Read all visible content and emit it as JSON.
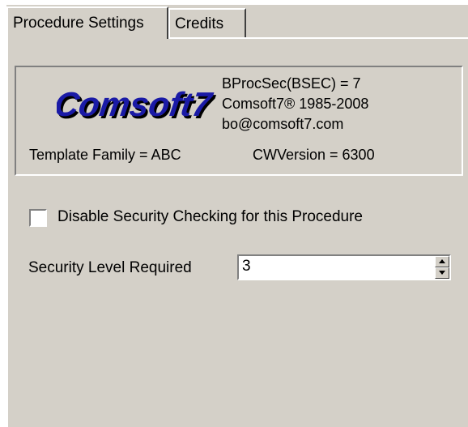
{
  "tabs": [
    {
      "label": "Procedure Settings",
      "active": true
    },
    {
      "label": "Credits",
      "active": false
    }
  ],
  "info": {
    "logo_text": "Comsoft7",
    "bproc": "BProcSec(BSEC) = 7",
    "copyright": "Comsoft7® 1985-2008",
    "email": "bo@comsoft7.com",
    "template_family": "Template Family = ABC",
    "cw_version": "CWVersion = 6300"
  },
  "security": {
    "disable_checkbox_label": "Disable Security Checking for this Procedure",
    "disable_checked": false,
    "level_label": "Security Level Required",
    "level_value": "3"
  },
  "colors": {
    "face": "#d4d0c8",
    "logo_fill": "#1a1aa6",
    "logo_shadow": "#000000"
  }
}
